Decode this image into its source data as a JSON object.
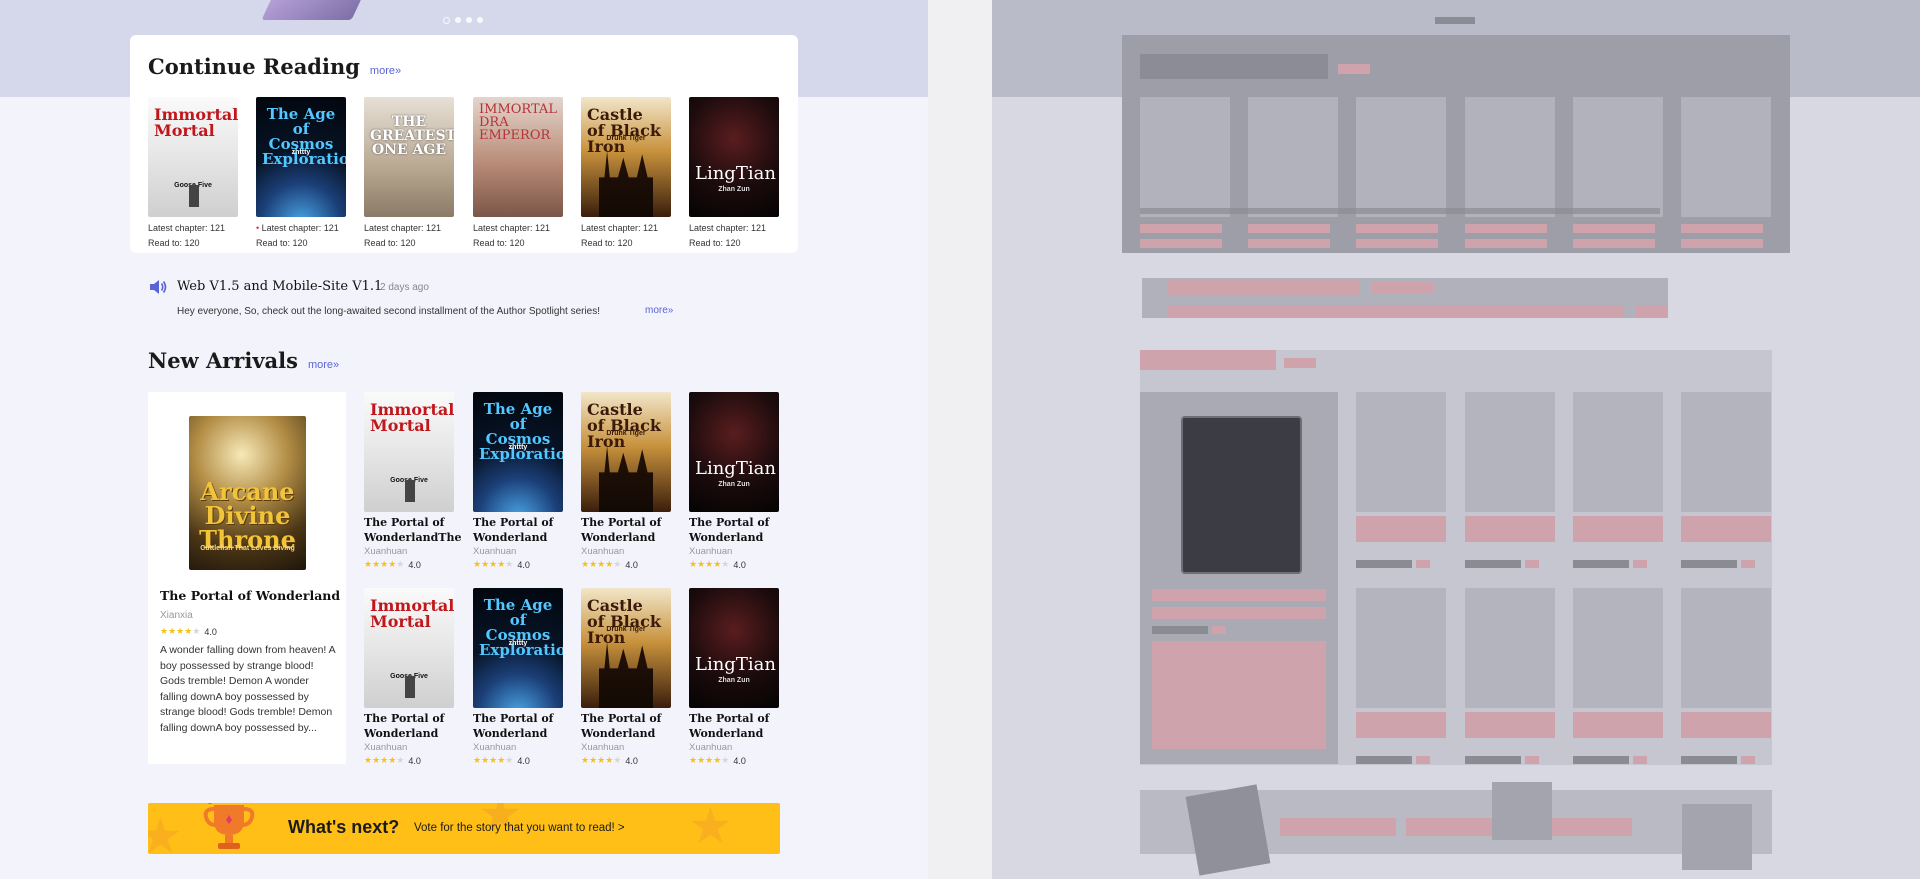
{
  "continue_reading": {
    "title": "Continue Reading",
    "more": "more»",
    "books": [
      {
        "cover_title": "Immortal Mortal",
        "cover_sub": "Goose Five",
        "chapter": "Latest chapter: 121",
        "read": "Read to: 120",
        "has_update": false,
        "style": "immortal"
      },
      {
        "cover_title": "The Age of Cosmos Exploration",
        "cover_sub": "zhttty",
        "chapter": "Latest chapter: 121",
        "read": "Read to: 120",
        "has_update": true,
        "style": "cosmos"
      },
      {
        "cover_title": "THE GREATEST ONE AGE",
        "cover_sub": "",
        "chapter": "Latest chapter: 121",
        "read": "Read to: 120",
        "has_update": false,
        "style": "greatest"
      },
      {
        "cover_title": "IMMORTAL DRA EMPEROR",
        "cover_sub": "",
        "chapter": "Latest chapter: 121",
        "read": "Read to: 120",
        "has_update": false,
        "style": "emperor"
      },
      {
        "cover_title": "Castle of Black Iron",
        "cover_sub": "Drunk Tiger",
        "chapter": "Latest chapter: 121",
        "read": "Read to: 120",
        "has_update": false,
        "style": "castle"
      },
      {
        "cover_title": "LingTian",
        "cover_sub": "Zhan Zun",
        "chapter": "Latest chapter: 121",
        "read": "Read to: 120",
        "has_update": false,
        "style": "lingtian"
      }
    ]
  },
  "announcement": {
    "title": "Web V1.5 and Mobile-Site V1.1",
    "time": "2 days ago",
    "body": "Hey everyone, So, check out the long-awaited second installment of the Author Spotlight series!",
    "more": "more»"
  },
  "new_arrivals": {
    "title": "New Arrivals",
    "more": "more»",
    "featured": {
      "cover_title": "Arcane Divine Throne",
      "cover_sub": "Cuttlefish That Loves Diving",
      "title": "The Portal of Wonderland",
      "genre": "Xianxia",
      "rating": "4.0",
      "stars": 4,
      "blurb": "A wonder falling down from heaven! A boy possessed by strange blood! Gods tremble! Demon A wonder falling downA boy possessed by strange blood! Gods tremble! Demon falling downA boy possessed by..."
    },
    "books": [
      {
        "cover_title": "Immortal Mortal",
        "cover_sub": "Goose Five",
        "style": "immortal",
        "title": "The Portal of WonderlandThe",
        "genre": "Xuanhuan",
        "rating": "4.0",
        "stars": 4
      },
      {
        "cover_title": "The Age of Cosmos Exploration",
        "cover_sub": "zhttty",
        "style": "cosmos",
        "title": "The Portal of Wonderland",
        "genre": "Xuanhuan",
        "rating": "4.0",
        "stars": 4
      },
      {
        "cover_title": "Castle of Black Iron",
        "cover_sub": "Drunk Tiger",
        "style": "castle",
        "title": "The Portal of Wonderland",
        "genre": "Xuanhuan",
        "rating": "4.0",
        "stars": 4
      },
      {
        "cover_title": "LingTian",
        "cover_sub": "Zhan Zun",
        "style": "lingtian",
        "title": "The Portal of Wonderland",
        "genre": "Xuanhuan",
        "rating": "4.0",
        "stars": 4
      },
      {
        "cover_title": "Immortal Mortal",
        "cover_sub": "Goose Five",
        "style": "immortal",
        "title": "The Portal of Wonderland",
        "genre": "Xuanhuan",
        "rating": "4.0",
        "stars": 4
      },
      {
        "cover_title": "The Age of Cosmos Exploration",
        "cover_sub": "zhttty",
        "style": "cosmos",
        "title": "The Portal of Wonderland",
        "genre": "Xuanhuan",
        "rating": "4.0",
        "stars": 4
      },
      {
        "cover_title": "Castle of Black Iron",
        "cover_sub": "Drunk Tiger",
        "style": "castle",
        "title": "The Portal of Wonderland",
        "genre": "Xuanhuan",
        "rating": "4.0",
        "stars": 4
      },
      {
        "cover_title": "LingTian",
        "cover_sub": "Zhan Zun",
        "style": "lingtian",
        "title": "The Portal of Wonderland",
        "genre": "Xuanhuan",
        "rating": "4.0",
        "stars": 4
      }
    ]
  },
  "banner": {
    "title": "What's next?",
    "subtitle": "Vote for the story that you want to read! >"
  },
  "carousel": {
    "count": 4,
    "active": 0
  },
  "colors": {
    "accent": "#5a63d6",
    "banner": "#ffbf17",
    "star": "#f6c21a",
    "update_dot": "#e5303a"
  }
}
